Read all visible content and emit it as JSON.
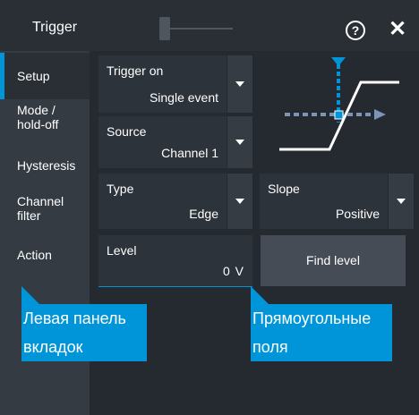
{
  "dialog": {
    "title": "Trigger",
    "help_symbol": "?",
    "close_symbol": "✕"
  },
  "sidebar": {
    "tabs": [
      {
        "label": "Setup",
        "active": true
      },
      {
        "label": "Mode /\nhold-off"
      },
      {
        "label": "Hysteresis"
      },
      {
        "label": "Channel\nfilter"
      },
      {
        "label": "Action"
      }
    ]
  },
  "fields": {
    "trigger_on": {
      "label": "Trigger on",
      "value": "Single event"
    },
    "source": {
      "label": "Source",
      "value": "Channel 1"
    },
    "type": {
      "label": "Type",
      "value": "Edge"
    },
    "slope": {
      "label": "Slope",
      "value": "Positive"
    },
    "level": {
      "label": "Level",
      "value": "0 V"
    }
  },
  "buttons": {
    "find_level": "Find level"
  },
  "callouts": {
    "left_panel_line1": "Левая панель",
    "left_panel_line2": "вкладок",
    "fields_line1": "Прямоугольные",
    "fields_line2": "поля"
  },
  "colors": {
    "accent": "#0095d9",
    "background": "#2a2f36",
    "field": "#2d333a"
  },
  "icons": {
    "help": "help-icon",
    "close": "close-icon",
    "dropdown": "chevron-down-icon",
    "trigger_diagram": "edge-trigger-diagram-icon"
  }
}
